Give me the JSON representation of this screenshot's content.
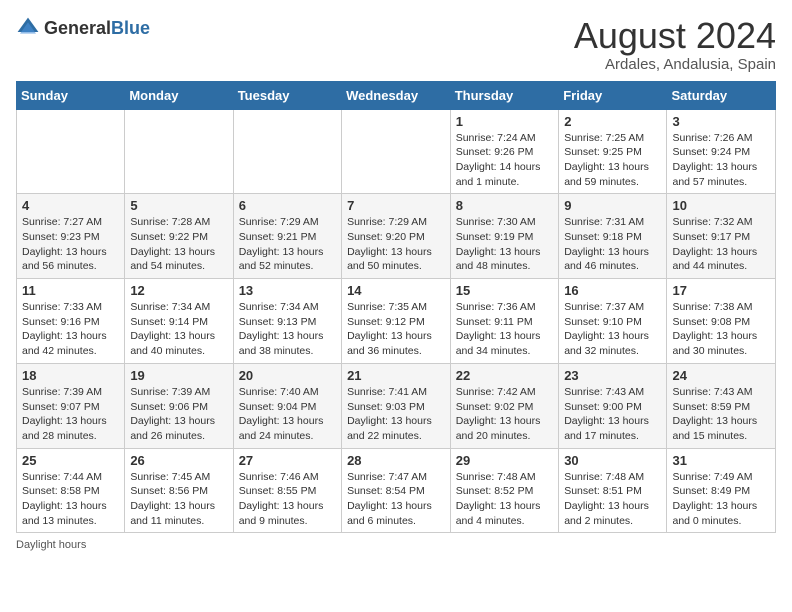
{
  "header": {
    "logo_general": "General",
    "logo_blue": "Blue",
    "main_title": "August 2024",
    "subtitle": "Ardales, Andalusia, Spain"
  },
  "calendar": {
    "days_of_week": [
      "Sunday",
      "Monday",
      "Tuesday",
      "Wednesday",
      "Thursday",
      "Friday",
      "Saturday"
    ],
    "weeks": [
      [
        {
          "day": "",
          "info": ""
        },
        {
          "day": "",
          "info": ""
        },
        {
          "day": "",
          "info": ""
        },
        {
          "day": "",
          "info": ""
        },
        {
          "day": "1",
          "info": "Sunrise: 7:24 AM\nSunset: 9:26 PM\nDaylight: 14 hours\nand 1 minute."
        },
        {
          "day": "2",
          "info": "Sunrise: 7:25 AM\nSunset: 9:25 PM\nDaylight: 13 hours\nand 59 minutes."
        },
        {
          "day": "3",
          "info": "Sunrise: 7:26 AM\nSunset: 9:24 PM\nDaylight: 13 hours\nand 57 minutes."
        }
      ],
      [
        {
          "day": "4",
          "info": "Sunrise: 7:27 AM\nSunset: 9:23 PM\nDaylight: 13 hours\nand 56 minutes."
        },
        {
          "day": "5",
          "info": "Sunrise: 7:28 AM\nSunset: 9:22 PM\nDaylight: 13 hours\nand 54 minutes."
        },
        {
          "day": "6",
          "info": "Sunrise: 7:29 AM\nSunset: 9:21 PM\nDaylight: 13 hours\nand 52 minutes."
        },
        {
          "day": "7",
          "info": "Sunrise: 7:29 AM\nSunset: 9:20 PM\nDaylight: 13 hours\nand 50 minutes."
        },
        {
          "day": "8",
          "info": "Sunrise: 7:30 AM\nSunset: 9:19 PM\nDaylight: 13 hours\nand 48 minutes."
        },
        {
          "day": "9",
          "info": "Sunrise: 7:31 AM\nSunset: 9:18 PM\nDaylight: 13 hours\nand 46 minutes."
        },
        {
          "day": "10",
          "info": "Sunrise: 7:32 AM\nSunset: 9:17 PM\nDaylight: 13 hours\nand 44 minutes."
        }
      ],
      [
        {
          "day": "11",
          "info": "Sunrise: 7:33 AM\nSunset: 9:16 PM\nDaylight: 13 hours\nand 42 minutes."
        },
        {
          "day": "12",
          "info": "Sunrise: 7:34 AM\nSunset: 9:14 PM\nDaylight: 13 hours\nand 40 minutes."
        },
        {
          "day": "13",
          "info": "Sunrise: 7:34 AM\nSunset: 9:13 PM\nDaylight: 13 hours\nand 38 minutes."
        },
        {
          "day": "14",
          "info": "Sunrise: 7:35 AM\nSunset: 9:12 PM\nDaylight: 13 hours\nand 36 minutes."
        },
        {
          "day": "15",
          "info": "Sunrise: 7:36 AM\nSunset: 9:11 PM\nDaylight: 13 hours\nand 34 minutes."
        },
        {
          "day": "16",
          "info": "Sunrise: 7:37 AM\nSunset: 9:10 PM\nDaylight: 13 hours\nand 32 minutes."
        },
        {
          "day": "17",
          "info": "Sunrise: 7:38 AM\nSunset: 9:08 PM\nDaylight: 13 hours\nand 30 minutes."
        }
      ],
      [
        {
          "day": "18",
          "info": "Sunrise: 7:39 AM\nSunset: 9:07 PM\nDaylight: 13 hours\nand 28 minutes."
        },
        {
          "day": "19",
          "info": "Sunrise: 7:39 AM\nSunset: 9:06 PM\nDaylight: 13 hours\nand 26 minutes."
        },
        {
          "day": "20",
          "info": "Sunrise: 7:40 AM\nSunset: 9:04 PM\nDaylight: 13 hours\nand 24 minutes."
        },
        {
          "day": "21",
          "info": "Sunrise: 7:41 AM\nSunset: 9:03 PM\nDaylight: 13 hours\nand 22 minutes."
        },
        {
          "day": "22",
          "info": "Sunrise: 7:42 AM\nSunset: 9:02 PM\nDaylight: 13 hours\nand 20 minutes."
        },
        {
          "day": "23",
          "info": "Sunrise: 7:43 AM\nSunset: 9:00 PM\nDaylight: 13 hours\nand 17 minutes."
        },
        {
          "day": "24",
          "info": "Sunrise: 7:43 AM\nSunset: 8:59 PM\nDaylight: 13 hours\nand 15 minutes."
        }
      ],
      [
        {
          "day": "25",
          "info": "Sunrise: 7:44 AM\nSunset: 8:58 PM\nDaylight: 13 hours\nand 13 minutes."
        },
        {
          "day": "26",
          "info": "Sunrise: 7:45 AM\nSunset: 8:56 PM\nDaylight: 13 hours\nand 11 minutes."
        },
        {
          "day": "27",
          "info": "Sunrise: 7:46 AM\nSunset: 8:55 PM\nDaylight: 13 hours\nand 9 minutes."
        },
        {
          "day": "28",
          "info": "Sunrise: 7:47 AM\nSunset: 8:54 PM\nDaylight: 13 hours\nand 6 minutes."
        },
        {
          "day": "29",
          "info": "Sunrise: 7:48 AM\nSunset: 8:52 PM\nDaylight: 13 hours\nand 4 minutes."
        },
        {
          "day": "30",
          "info": "Sunrise: 7:48 AM\nSunset: 8:51 PM\nDaylight: 13 hours\nand 2 minutes."
        },
        {
          "day": "31",
          "info": "Sunrise: 7:49 AM\nSunset: 8:49 PM\nDaylight: 13 hours\nand 0 minutes."
        }
      ]
    ],
    "footer_note": "Daylight hours"
  }
}
